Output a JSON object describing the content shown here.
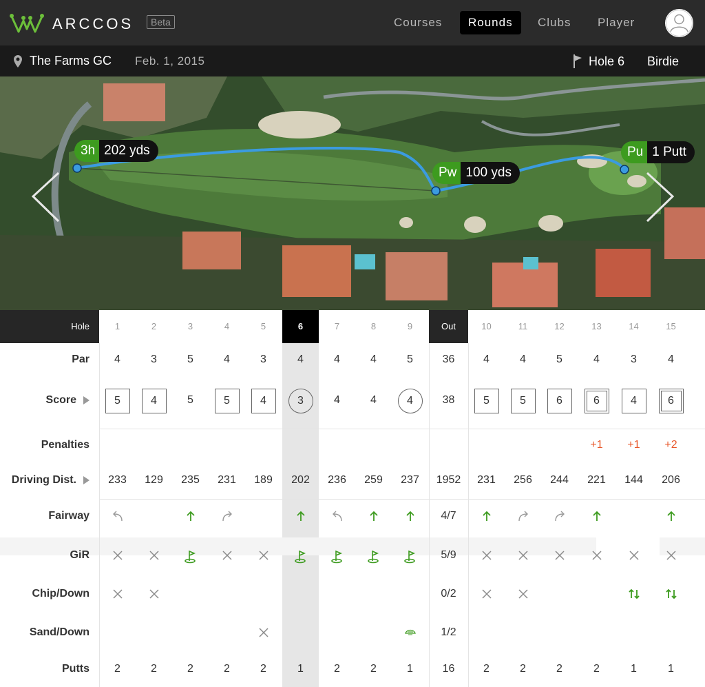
{
  "app": {
    "brand": "ARCCOS",
    "beta_label": "Beta"
  },
  "nav": {
    "courses": "Courses",
    "rounds": "Rounds",
    "clubs": "Clubs",
    "player": "Player"
  },
  "round": {
    "course": "The Farms GC",
    "date": "Feb. 1, 2015",
    "hole_label": "Hole 6",
    "result": "Birdie"
  },
  "shots": [
    {
      "club": "3h",
      "distance": "202 yds"
    },
    {
      "club": "Pw",
      "distance": "100 yds"
    },
    {
      "club": "Pu",
      "distance": "1 Putt"
    }
  ],
  "colors": {
    "accent_green": "#3d9b1f",
    "penalty": "#e8572a",
    "shot_line": "#3b9be0"
  },
  "scorecard": {
    "header_label": "Hole",
    "out_label": "Out",
    "row_labels": {
      "par": "Par",
      "score": "Score",
      "penalties": "Penalties",
      "driving": "Driving Dist.",
      "fairway": "Fairway",
      "gir": "GiR",
      "chip": "Chip/Down",
      "sand": "Sand/Down",
      "putts": "Putts"
    },
    "holes": [
      "1",
      "2",
      "3",
      "4",
      "5",
      "6",
      "7",
      "8",
      "9",
      "10",
      "11",
      "12",
      "13",
      "14",
      "15"
    ],
    "par": [
      "4",
      "3",
      "5",
      "4",
      "3",
      "4",
      "4",
      "4",
      "5",
      "4",
      "4",
      "5",
      "4",
      "3",
      "4"
    ],
    "par_out": "36",
    "score": [
      "5",
      "4",
      "5",
      "5",
      "4",
      "3",
      "4",
      "4",
      "4",
      "5",
      "5",
      "6",
      "6",
      "4",
      "6"
    ],
    "score_marks": [
      "square",
      "square",
      "none",
      "square",
      "square",
      "circle",
      "none",
      "none",
      "circle",
      "square",
      "square",
      "square",
      "double-square",
      "square",
      "double-square"
    ],
    "score_out": "38",
    "penalties": [
      "",
      "",
      "",
      "",
      "",
      "",
      "",
      "",
      "",
      "",
      "",
      "",
      "+1",
      "+1",
      "+2"
    ],
    "driving": [
      "233",
      "129",
      "235",
      "231",
      "189",
      "202",
      "236",
      "259",
      "237",
      "231",
      "256",
      "244",
      "221",
      "144",
      "206"
    ],
    "driving_out": "1952",
    "fairway": [
      "miss-left",
      "",
      "hit",
      "miss-right",
      "",
      "hit",
      "miss-left",
      "hit",
      "hit",
      "hit",
      "miss-right",
      "miss-right",
      "hit",
      "",
      "hit"
    ],
    "fairway_out": "4/7",
    "gir": [
      "x",
      "x",
      "flag",
      "x",
      "x",
      "flag",
      "flag",
      "flag",
      "flag",
      "x",
      "x",
      "x",
      "x",
      "x",
      "x"
    ],
    "gir_out": "5/9",
    "chip": [
      "x",
      "x",
      "",
      "",
      "",
      "",
      "",
      "",
      "",
      "x",
      "x",
      "",
      "",
      "updown",
      "updown"
    ],
    "chip_out": "0/2",
    "sand": [
      "",
      "",
      "",
      "",
      "x",
      "",
      "",
      "",
      "bunker",
      "",
      "",
      "",
      "",
      "",
      ""
    ],
    "sand_out": "1/2",
    "putts": [
      "2",
      "2",
      "2",
      "2",
      "2",
      "1",
      "2",
      "2",
      "1",
      "2",
      "2",
      "2",
      "2",
      "1",
      "1"
    ],
    "putts_out": "16"
  }
}
